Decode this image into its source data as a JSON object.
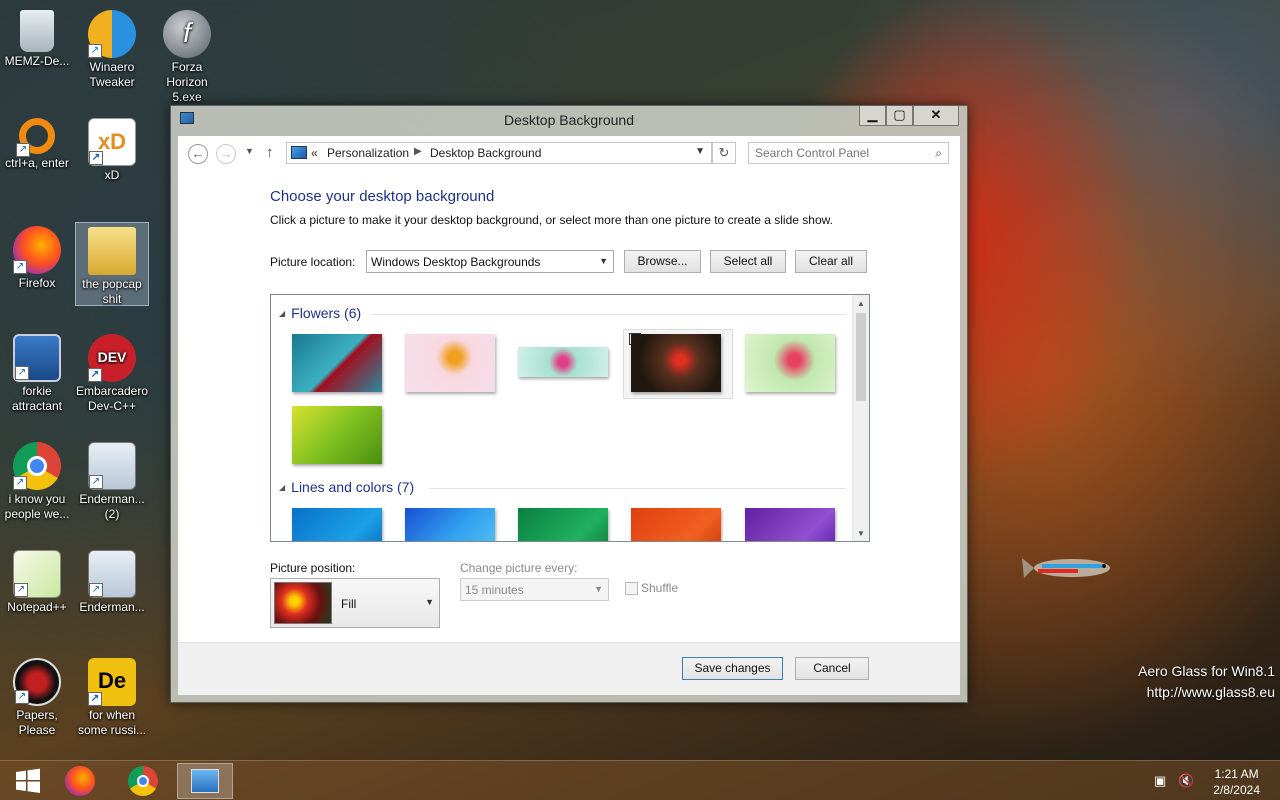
{
  "desktop": {
    "icons": [
      {
        "label": "MEMZ-De...",
        "icon": "recycle-bin-icon"
      },
      {
        "label": "Winaero Tweaker",
        "icon": "winaero-icon"
      },
      {
        "label": "Forza Horizon 5.exe",
        "icon": "flash-icon"
      },
      {
        "label": "ctrl+a, enter",
        "icon": "orange-ring-icon"
      },
      {
        "label": "xD",
        "icon": "hxd-icon"
      },
      {
        "label": "Firefox",
        "icon": "firefox-icon"
      },
      {
        "label": "the popcap shit",
        "icon": "folder-icon"
      },
      {
        "label": "forkie attractant",
        "icon": "settings-monitor-icon"
      },
      {
        "label": "Embarcadero Dev-C++",
        "icon": "devcpp-icon"
      },
      {
        "label": "i know you people we...",
        "icon": "chrome-icon"
      },
      {
        "label": "Enderman... (2)",
        "icon": "window-icon"
      },
      {
        "label": "Notepad++",
        "icon": "notepadpp-icon"
      },
      {
        "label": "Enderman...",
        "icon": "window-icon"
      },
      {
        "label": "Papers, Please",
        "icon": "papers-please-icon"
      },
      {
        "label": "for when some russi...",
        "icon": "de-icon"
      }
    ],
    "watermark": {
      "line1": "Aero Glass for Win8.1",
      "line2": "http://www.glass8.eu"
    }
  },
  "window": {
    "title": "Desktop Background",
    "controls": {
      "minimize": "▁",
      "maximize": "▢",
      "close": "✕"
    },
    "nav": {
      "back": "←",
      "forward": "→",
      "dropdown": "▼",
      "up": "↑",
      "address_prefix": "«",
      "breadcrumb": [
        "Personalization",
        "Desktop Background"
      ],
      "separator": "▶",
      "chevron": "▼",
      "refresh": "↻",
      "search_placeholder": "Search Control Panel",
      "search_icon": "⌕"
    },
    "heading": "Choose your desktop background",
    "subtext": "Click a picture to make it your desktop background, or select more than one picture to create a slide show.",
    "picture_location": {
      "label": "Picture location:",
      "value": "Windows Desktop Backgrounds",
      "caret": "▼"
    },
    "buttons": {
      "browse": "Browse...",
      "select_all": "Select all",
      "clear_all": "Clear all"
    },
    "groups": [
      {
        "name": "Flowers (6)",
        "expander": "◢"
      },
      {
        "name": "Lines and colors (7)",
        "expander": "◢"
      }
    ],
    "check_mark": "✓",
    "scroll_arrows": {
      "up": "▲",
      "down": "▼"
    },
    "picture_position": {
      "label": "Picture position:",
      "value": "Fill",
      "caret": "▼"
    },
    "change_every": {
      "label": "Change picture every:",
      "value": "15 minutes",
      "caret": "▼"
    },
    "shuffle": {
      "label": "Shuffle",
      "checked": false
    },
    "footer": {
      "save": "Save changes",
      "cancel": "Cancel"
    }
  },
  "taskbar": {
    "clock_time": "1:21 AM",
    "clock_date": "2/8/2024",
    "tray_network": "▣",
    "tray_volume": "🔇",
    "items": [
      "start-button",
      "firefox",
      "chrome",
      "control-panel"
    ]
  },
  "colors": {
    "accent_link": "#1e3287",
    "taskbar": "#7a5028",
    "button_border_default": "#3c7fb1"
  }
}
